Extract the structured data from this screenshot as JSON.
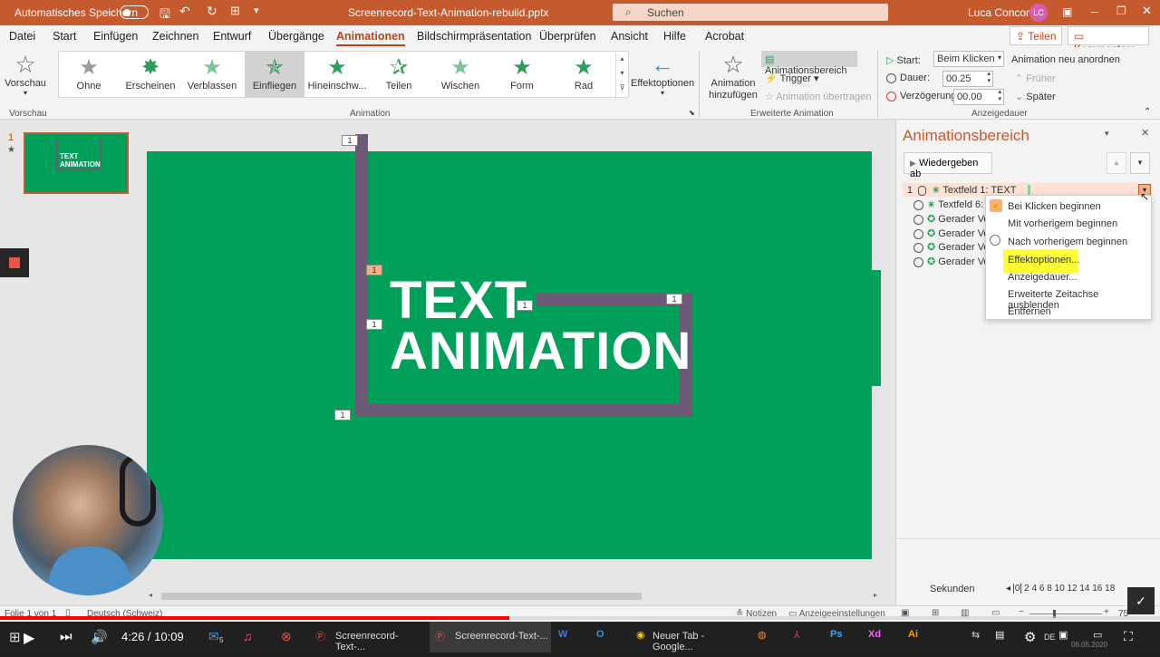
{
  "titlebar": {
    "autosave_label": "Automatisches Speichern",
    "autosave_state": "Aus",
    "filename": "Screenrecord-Text-Animation-rebuild.pptx",
    "search_placeholder": "Suchen",
    "user_name": "Luca Conconi",
    "user_initials": "LC"
  },
  "tabs": [
    "Datei",
    "Start",
    "Einfügen",
    "Zeichnen",
    "Entwurf",
    "Übergänge",
    "Animationen",
    "Bildschirmpräsentation",
    "Überprüfen",
    "Ansicht",
    "Hilfe",
    "Acrobat"
  ],
  "active_tab": "Animationen",
  "share_label": "Teilen",
  "comments_label": "Kommentare",
  "ribbon": {
    "preview_label": "Vorschau",
    "preview_group": "Vorschau",
    "gallery": [
      "Ohne",
      "Erscheinen",
      "Verblassen",
      "Einfliegen",
      "Hineinschw...",
      "Teilen",
      "Wischen",
      "Form",
      "Rad"
    ],
    "gallery_selected": "Einfliegen",
    "effect_options": "Effektoptionen",
    "animation_group": "Animation",
    "add_animation": "Animation hinzufügen",
    "animation_pane_btn": "Animationsbereich",
    "trigger": "Trigger",
    "animation_painter": "Animation übertragen",
    "advanced_group": "Erweiterte Animation",
    "start_label": "Start:",
    "start_value": "Beim Klicken",
    "duration_label": "Dauer:",
    "duration_value": "00.25",
    "delay_label": "Verzögerung:",
    "delay_value": "00.00",
    "reorder_label": "Animation neu anordnen",
    "earlier": "Früher",
    "later": "Später",
    "timing_group": "Anzeigedauer"
  },
  "thumbnail": {
    "number": "1",
    "text_line1": "TEXT",
    "text_line2": "ANIMATION"
  },
  "slide": {
    "line1": "TEXT",
    "line2": "ANIMATION",
    "badges": [
      "1",
      "1",
      "1",
      "1",
      "1",
      "1"
    ]
  },
  "anim_pane": {
    "title": "Animationsbereich",
    "play_from": "Wiedergeben ab",
    "items": [
      {
        "num": "1",
        "label": "Textfeld 1: TEXT"
      },
      {
        "num": "",
        "label": "Textfeld 6:"
      },
      {
        "num": "",
        "label": "Gerader Ve"
      },
      {
        "num": "",
        "label": "Gerader Ve"
      },
      {
        "num": "",
        "label": "Gerader Ve"
      },
      {
        "num": "",
        "label": "Gerader Ve"
      }
    ],
    "seconds_label": "Sekunden",
    "seconds_ticks": [
      "0",
      "2",
      "4",
      "6",
      "8",
      "10",
      "12",
      "14",
      "16",
      "18"
    ]
  },
  "context_menu": [
    "Bei Klicken beginnen",
    "Mit vorherigem beginnen",
    "Nach vorherigem beginnen",
    "Effektoptionen...",
    "Anzeigedauer...",
    "Erweiterte Zeitachse ausblenden",
    "Entfernen"
  ],
  "context_menu_highlighted": "Effektoptionen...",
  "statusbar": {
    "slide_info": "Folie 1 von 1",
    "language": "Deutsch (Schweiz)",
    "notes": "Notizen",
    "display_settings": "Anzeigeeinstellungen",
    "zoom": "75"
  },
  "video": {
    "time": "4:26 / 10:09",
    "progress": 0.439
  },
  "taskbar": {
    "items": [
      "Screenrecord-Text-...",
      "Screenrecord-Text-...",
      "Neuer Tab - Google..."
    ],
    "lang": "DE",
    "date": "06.05.2020",
    "mail_badge": "5"
  },
  "colors": {
    "accent": "#c55a2f",
    "slide_green": "#00a05a",
    "path_purple": "#6e5977",
    "highlight_yellow": "#ffff33"
  }
}
